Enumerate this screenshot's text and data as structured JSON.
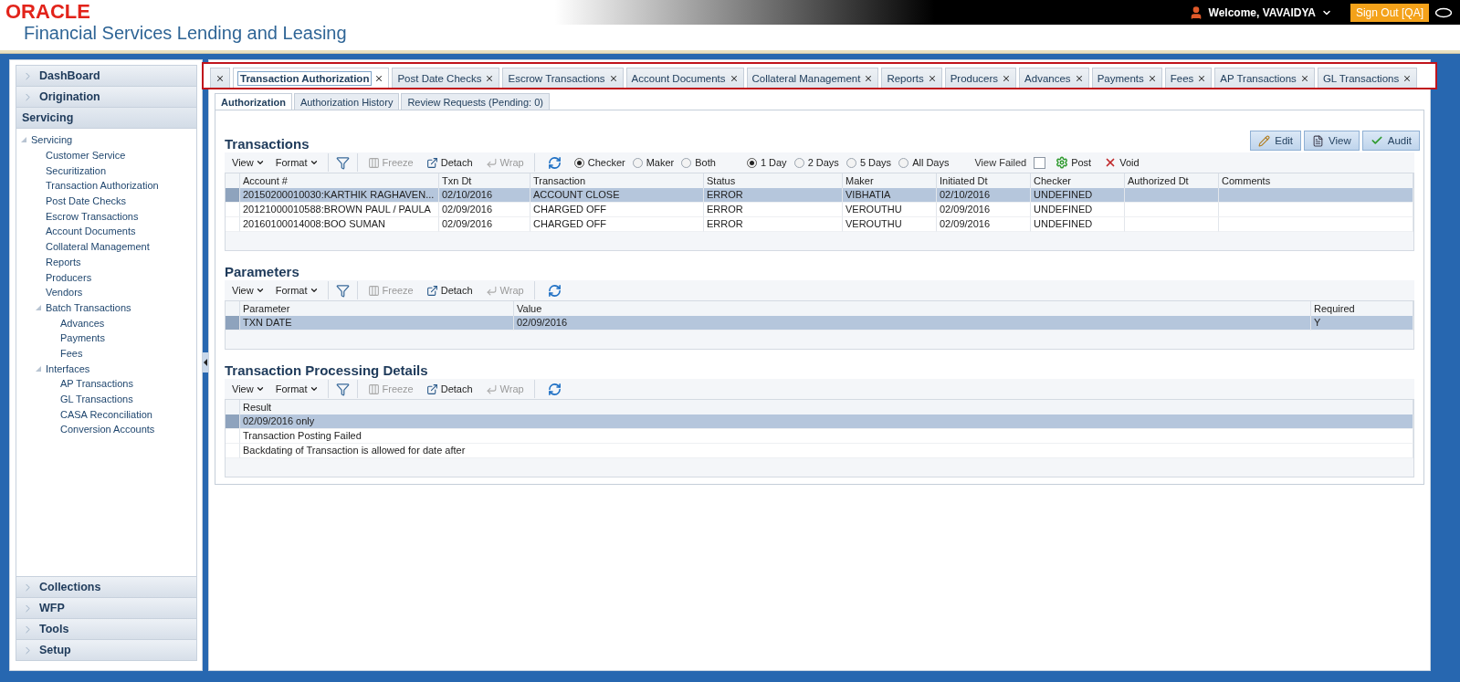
{
  "header": {
    "logo": "ORACLE",
    "title": "Financial Services Lending and Leasing",
    "welcome": "Welcome, VAVAIDYA",
    "signout": "Sign Out [QA]"
  },
  "sidebar": {
    "top": [
      {
        "label": "DashBoard",
        "expanded": false
      },
      {
        "label": "Origination",
        "expanded": false
      },
      {
        "label": "Servicing",
        "expanded": true
      }
    ],
    "tree": [
      {
        "label": "Servicing",
        "children": [
          {
            "label": "Customer Service"
          },
          {
            "label": "Securitization"
          },
          {
            "label": "Transaction Authorization"
          },
          {
            "label": "Post Date Checks"
          },
          {
            "label": "Escrow Transactions"
          },
          {
            "label": "Account Documents"
          },
          {
            "label": "Collateral Management"
          },
          {
            "label": "Reports"
          },
          {
            "label": "Producers"
          },
          {
            "label": "Vendors"
          },
          {
            "label": "Batch Transactions",
            "children": [
              {
                "label": "Advances"
              },
              {
                "label": "Payments"
              },
              {
                "label": "Fees"
              }
            ]
          },
          {
            "label": "Interfaces",
            "children": [
              {
                "label": "AP Transactions"
              },
              {
                "label": "GL Transactions"
              },
              {
                "label": "CASA Reconciliation"
              },
              {
                "label": "Conversion Accounts"
              }
            ]
          }
        ]
      }
    ],
    "bottom": [
      {
        "label": "Collections",
        "expanded": false
      },
      {
        "label": "WFP",
        "expanded": false
      },
      {
        "label": "Tools",
        "expanded": false
      },
      {
        "label": "Setup",
        "expanded": false
      }
    ]
  },
  "tabs": [
    {
      "kind": "partial",
      "selected": false
    },
    {
      "kind": "tab",
      "label": "Transaction Authorization",
      "selected": true
    },
    {
      "kind": "tab",
      "label": "Post Date Checks",
      "selected": false
    },
    {
      "kind": "tab",
      "label": "Escrow Transactions",
      "selected": false
    },
    {
      "kind": "tab",
      "label": "Account Documents",
      "selected": false
    },
    {
      "kind": "tab",
      "label": "Collateral Management",
      "selected": false
    },
    {
      "kind": "tab",
      "label": "Reports",
      "selected": false
    },
    {
      "kind": "tab",
      "label": "Producers",
      "selected": false
    },
    {
      "kind": "tab",
      "label": "Advances",
      "selected": false
    },
    {
      "kind": "tab",
      "label": "Payments",
      "selected": false
    },
    {
      "kind": "tab",
      "label": "Fees",
      "selected": false
    },
    {
      "kind": "tab",
      "label": "AP Transactions",
      "selected": false
    },
    {
      "kind": "tab",
      "label": "GL Transactions",
      "selected": false
    }
  ],
  "subtabs": [
    {
      "label": "Authorization",
      "selected": true
    },
    {
      "label": "Authorization History",
      "selected": false
    },
    {
      "label": "Review Requests (Pending: 0)",
      "selected": false
    }
  ],
  "sections": [
    {
      "title": "Transactions",
      "actions": [
        {
          "kind": "edit",
          "label": "Edit"
        },
        {
          "kind": "view",
          "label": "View"
        },
        {
          "kind": "audit",
          "label": "Audit"
        }
      ],
      "toolbar": {
        "menus": [
          "View",
          "Format"
        ],
        "tools": [
          {
            "kind": "freeze",
            "label": "Freeze",
            "disabled": true
          },
          {
            "kind": "detach",
            "label": "Detach",
            "disabled": false
          },
          {
            "kind": "wrap",
            "label": "Wrap",
            "disabled": true
          }
        ]
      },
      "filters": {
        "roles": [
          {
            "label": "Checker",
            "selected": true
          },
          {
            "label": "Maker",
            "selected": false
          },
          {
            "label": "Both",
            "selected": false
          }
        ],
        "days": [
          {
            "label": "1 Day",
            "selected": true
          },
          {
            "label": "2 Days",
            "selected": false
          },
          {
            "label": "5 Days",
            "selected": false
          },
          {
            "label": "All Days",
            "selected": false
          }
        ],
        "view_failed": {
          "label": "View Failed",
          "checked": false
        },
        "buttons": [
          {
            "kind": "post",
            "label": "Post"
          },
          {
            "kind": "void",
            "label": "Void"
          }
        ]
      },
      "columns": [
        "Account #",
        "Txn Dt",
        "Transaction",
        "Status",
        "Maker",
        "Initiated Dt",
        "Checker",
        "Authorized Dt",
        "Comments"
      ],
      "rows": [
        {
          "selected": true,
          "cells": [
            "20150200010030:KARTHIK RAGHAVEN...",
            "02/10/2016",
            "ACCOUNT CLOSE",
            "ERROR",
            "VIBHATIA",
            "02/10/2016",
            "UNDEFINED"
          ]
        },
        {
          "selected": false,
          "cells": [
            "20121000010588:BROWN PAUL / PAULA",
            "02/09/2016",
            "CHARGED OFF",
            "ERROR",
            "VEROUTHU",
            "02/09/2016",
            "UNDEFINED"
          ]
        },
        {
          "selected": false,
          "cells": [
            "20160100014008:BOO SUMAN",
            "02/09/2016",
            "CHARGED OFF",
            "ERROR",
            "VEROUTHU",
            "02/09/2016",
            "UNDEFINED"
          ]
        }
      ]
    },
    {
      "title": "Parameters",
      "toolbar": {
        "menus": [
          "View",
          "Format"
        ],
        "tools": [
          {
            "kind": "freeze",
            "label": "Freeze",
            "disabled": true
          },
          {
            "kind": "detach",
            "label": "Detach",
            "disabled": false
          },
          {
            "kind": "wrap",
            "label": "Wrap",
            "disabled": true
          }
        ]
      },
      "columns": [
        "Parameter",
        "Value",
        "Required"
      ],
      "rows": [
        {
          "selected": true,
          "cells": [
            "TXN DATE",
            "02/09/2016",
            "Y"
          ]
        }
      ]
    },
    {
      "title": "Transaction Processing Details",
      "toolbar": {
        "menus": [
          "View",
          "Format"
        ],
        "tools": [
          {
            "kind": "freeze",
            "label": "Freeze",
            "disabled": true
          },
          {
            "kind": "detach",
            "label": "Detach",
            "disabled": false
          },
          {
            "kind": "wrap",
            "label": "Wrap",
            "disabled": true
          }
        ]
      },
      "columns": [
        "Result"
      ],
      "rows": [
        {
          "selected": true,
          "cells": [
            "02/09/2016 only"
          ]
        },
        {
          "selected": false,
          "cells": [
            "Transaction Posting Failed"
          ]
        },
        {
          "selected": false,
          "cells": [
            "Backdating of Transaction is allowed for date after"
          ]
        }
      ]
    }
  ]
}
